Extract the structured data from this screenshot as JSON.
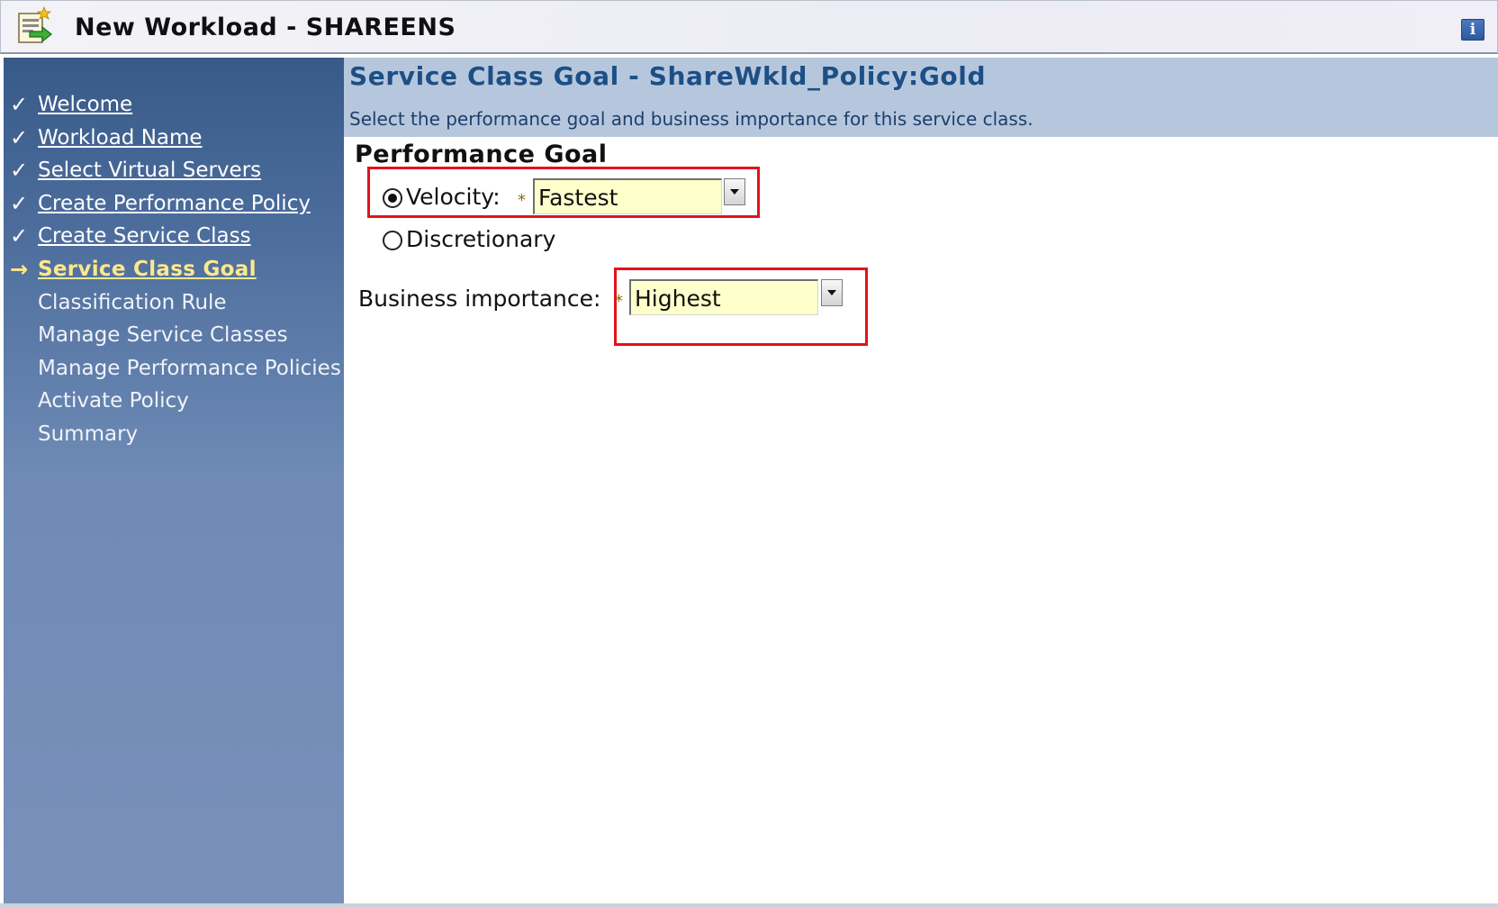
{
  "window": {
    "title": "New Workload - SHAREENS",
    "app_icon": "workload-wizard-icon",
    "info_icon": "info-icon",
    "info_glyph": "i"
  },
  "sidebar": {
    "items": [
      {
        "label": "Welcome",
        "state": "done",
        "mark": "✓"
      },
      {
        "label": "Workload Name",
        "state": "done",
        "mark": "✓"
      },
      {
        "label": "Select Virtual Servers",
        "state": "done",
        "mark": "✓"
      },
      {
        "label": "Create Performance Policy",
        "state": "done",
        "mark": "✓"
      },
      {
        "label": "Create Service Class",
        "state": "done",
        "mark": "✓"
      },
      {
        "label": "Service Class Goal",
        "state": "current",
        "mark": "→"
      },
      {
        "label": "Classification Rule",
        "state": "pending",
        "mark": ""
      },
      {
        "label": "Manage Service Classes",
        "state": "pending",
        "mark": ""
      },
      {
        "label": "Manage Performance Policies",
        "state": "pending",
        "mark": ""
      },
      {
        "label": "Activate Policy",
        "state": "pending",
        "mark": ""
      },
      {
        "label": "Summary",
        "state": "pending",
        "mark": ""
      }
    ]
  },
  "main": {
    "heading": "Service Class Goal - ShareWkld_Policy:Gold",
    "description": "Select the performance goal and business importance for this service class.",
    "performance_goal": {
      "title": "Performance Goal",
      "velocity_label": "Velocity:",
      "velocity_selected": true,
      "velocity_value": "Fastest",
      "discretionary_label": "Discretionary",
      "discretionary_selected": false
    },
    "business_importance": {
      "label": "Business importance:",
      "value": "Highest"
    },
    "required_marker": "*"
  },
  "colors": {
    "highlight": "#e2131b",
    "required_field_bg": "#ffffcc",
    "current_step": "#ffe88a",
    "heading": "#1c4f86"
  }
}
